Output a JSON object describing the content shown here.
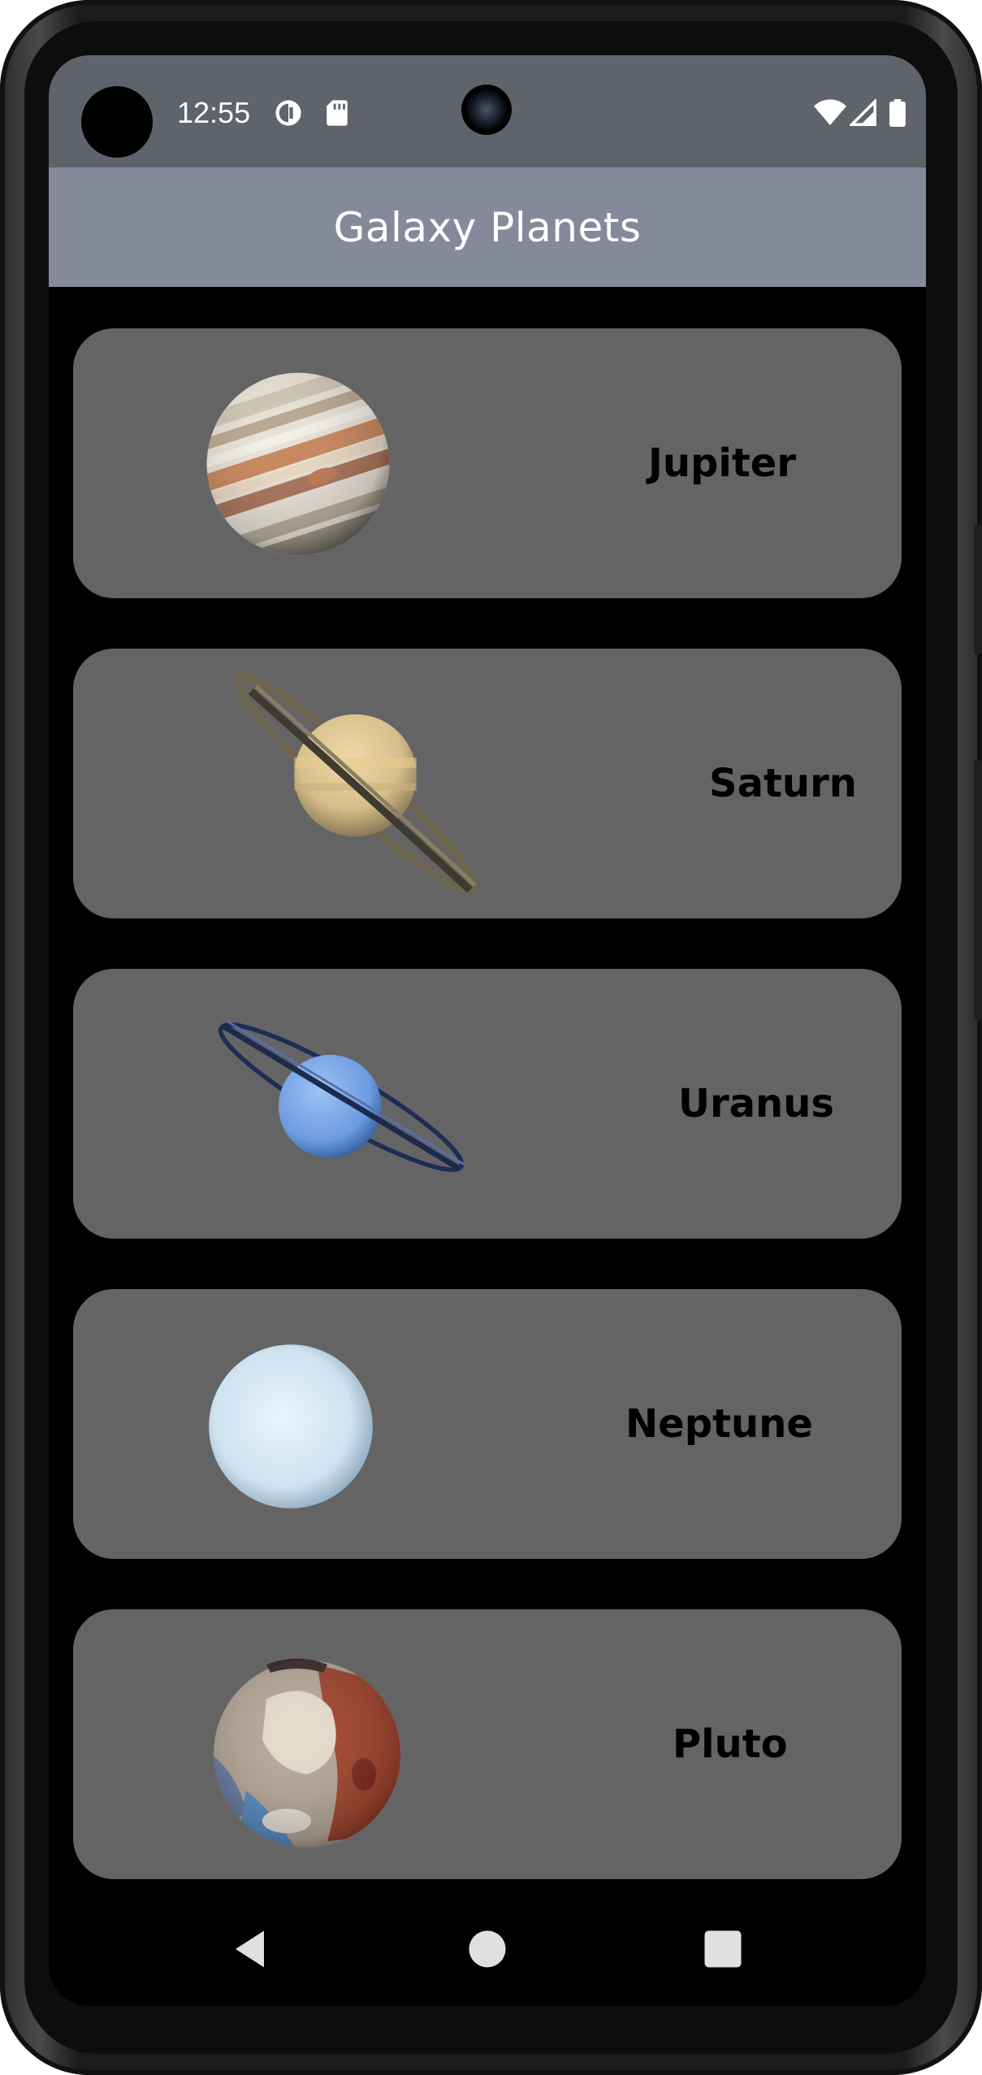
{
  "status_bar": {
    "time": "12:55",
    "icons": [
      "data-saver-icon",
      "sd-card-icon",
      "wifi-icon",
      "signal-icon",
      "battery-icon"
    ]
  },
  "app_bar": {
    "title": "Galaxy Planets",
    "color": "#848a99"
  },
  "planets": [
    {
      "name": "Jupiter",
      "image": "jupiter-image"
    },
    {
      "name": "Saturn",
      "image": "saturn-image"
    },
    {
      "name": "Uranus",
      "image": "uranus-image"
    },
    {
      "name": "Neptune",
      "image": "neptune-image"
    },
    {
      "name": "Pluto",
      "image": "pluto-image"
    }
  ],
  "nav_bar": {
    "icons": [
      "back-icon",
      "home-icon",
      "recents-icon"
    ]
  },
  "colors": {
    "status_bar": "#5f636b",
    "card": "#646464",
    "background": "#000000"
  }
}
